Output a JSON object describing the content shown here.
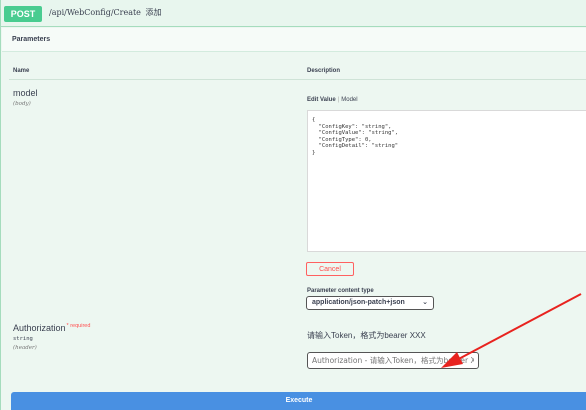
{
  "operation": {
    "method": "POST",
    "path": "/api/WebConfig/Create",
    "description": "添加"
  },
  "parameters_section": {
    "title": "Parameters",
    "col_name": "Name",
    "col_description": "Description"
  },
  "model_param": {
    "name": "model",
    "in": "(body)",
    "tab_edit": "Edit Value",
    "tab_model": "Model",
    "body_value": "{\n  \"ConfigKey\": \"string\",\n  \"ConfigValue\": \"string\",\n  \"ConfigType\": 0,\n  \"ConfigDetail\": \"string\"\n}",
    "cancel_label": "Cancel",
    "content_type_label": "Parameter content type",
    "content_type_value": "application/json-patch+json"
  },
  "auth_param": {
    "name": "Authorization",
    "required": "* required",
    "type": "string",
    "in": "(header)",
    "description": "请输入Token，格式为bearer XXX",
    "placeholder": "Authorization - 请输入Token，格式为bearer XXX"
  },
  "execute": {
    "label": "Execute"
  },
  "colors": {
    "post": "#49cc90",
    "execute": "#4990e2",
    "cancel": "#ff4f4f",
    "annotation_arrow": "#e8231f"
  }
}
